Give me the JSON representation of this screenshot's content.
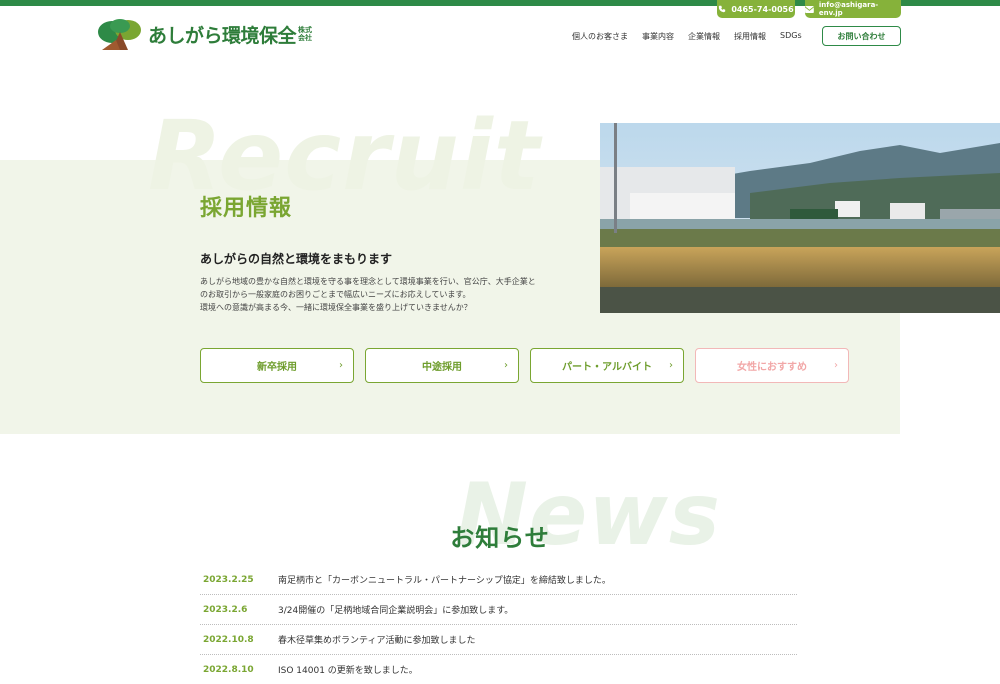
{
  "header": {
    "phone": "0465-74-0056",
    "email": "info@ashigara-env.jp",
    "logo_text": "あしがら環境保全",
    "logo_suffix_top": "株式",
    "logo_suffix_bottom": "会社",
    "nav": [
      "個人のお客さま",
      "事業内容",
      "企業情報",
      "採用情報",
      "SDGs"
    ],
    "contact_label": "お問い合わせ"
  },
  "hero": {
    "bg_word": "Recruit",
    "title": "採用情報",
    "subtitle": "あしがらの自然と環境をまもります",
    "body_lines": [
      "あしがら地域の豊かな自然と環境を守る事を理念として環境事業を行い、官公庁、大手企業と",
      "のお取引から一般家庭のお困りごとまで幅広いニーズにお応えしています。",
      "環境への意識が高まる今、一緒に環境保全事業を盛り上げていきませんか？"
    ],
    "buttons": [
      "新卒採用",
      "中途採用",
      "パート・アルバイト",
      "女性におすすめ"
    ]
  },
  "news": {
    "bg_word": "News",
    "title": "お知らせ",
    "items": [
      {
        "date": "2023.2.25",
        "text": "南足柄市と「カーボンニュートラル・パートナーシップ協定」を締結致しました。"
      },
      {
        "date": "2023.2.6",
        "text": "3/24開催の「足柄地域合同企業説明会」に参加致します。"
      },
      {
        "date": "2022.10.8",
        "text": "春木径草集めボランティア活動に参加致しました"
      },
      {
        "date": "2022.8.10",
        "text": "ISO 14001 の更新を致しました。"
      }
    ]
  },
  "colors": {
    "brand_green": "#2e8a47",
    "accent_green": "#7aa632",
    "hero_bg": "#f1f5e9",
    "pink": "#f2a7a7"
  }
}
